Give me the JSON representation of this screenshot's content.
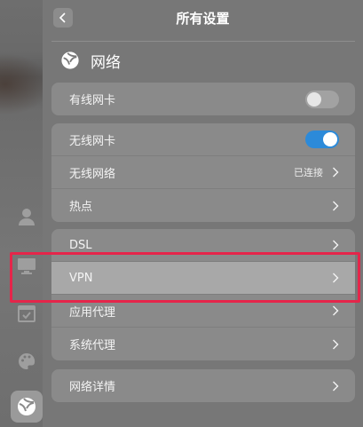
{
  "header": {
    "title": "所有设置"
  },
  "section": {
    "title": "网络"
  },
  "wired": {
    "label": "有线网卡",
    "enabled": false
  },
  "wireless": {
    "rows": [
      {
        "label": "无线网卡",
        "kind": "toggle",
        "enabled": true
      },
      {
        "label": "无线网络",
        "kind": "link",
        "status": "已连接"
      },
      {
        "label": "热点",
        "kind": "link"
      }
    ]
  },
  "advanced": {
    "rows": [
      {
        "label": "DSL"
      },
      {
        "label": "VPN"
      },
      {
        "label": "应用代理"
      },
      {
        "label": "系统代理"
      }
    ]
  },
  "details": {
    "label": "网络详情"
  },
  "colors": {
    "accent": "#2c8ad9",
    "callout": "#e5254a"
  },
  "left_rail": {
    "icons": [
      "account-icon",
      "display-icon",
      "default-apps-icon",
      "personalization-icon",
      "network-icon"
    ],
    "active": "network-icon"
  }
}
